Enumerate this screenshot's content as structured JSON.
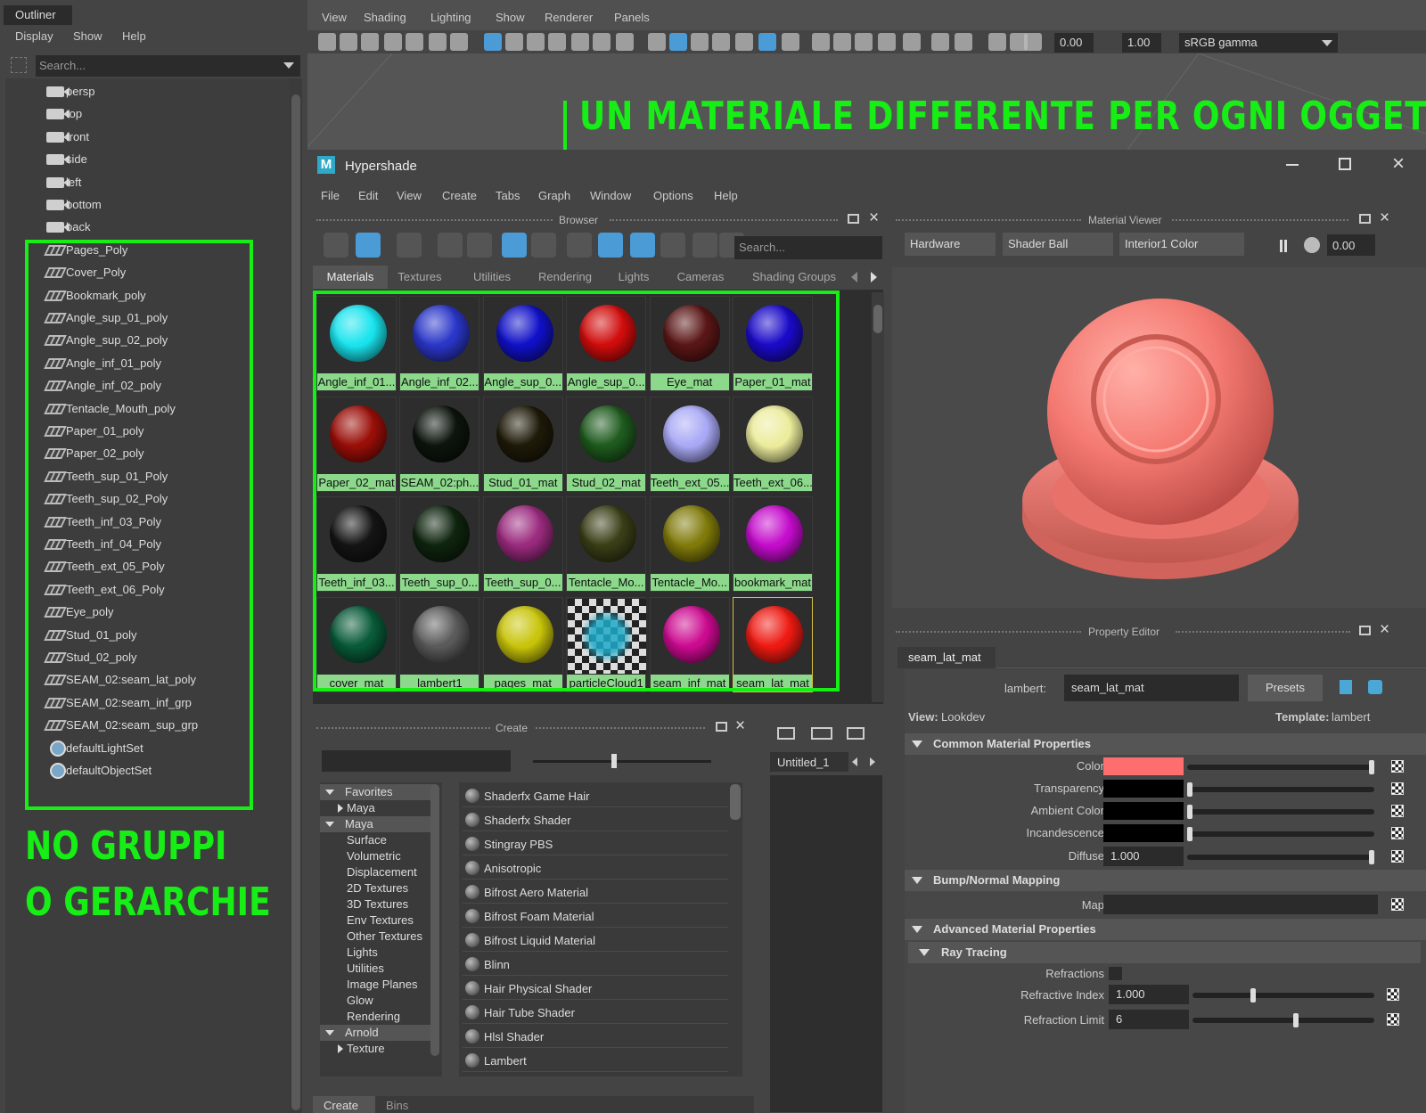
{
  "overlay": {
    "title": "UN MATERIALE DIFFERENTE PER OGNI OGGETTO",
    "note_line1": "NO GRUPPI",
    "note_line2": "O GERARCHIE",
    "accent": "#16ee16"
  },
  "outliner": {
    "title": "Outliner",
    "menu": [
      "Display",
      "Show",
      "Help"
    ],
    "search_placeholder": "Search...",
    "items": [
      {
        "label": "persp",
        "icon": "camera-icon"
      },
      {
        "label": "top",
        "icon": "camera-icon"
      },
      {
        "label": "front",
        "icon": "camera-icon"
      },
      {
        "label": "side",
        "icon": "camera-icon"
      },
      {
        "label": "left",
        "icon": "camera-icon"
      },
      {
        "label": "bottom",
        "icon": "camera-icon"
      },
      {
        "label": "back",
        "icon": "camera-icon"
      },
      {
        "label": "Pages_Poly",
        "icon": "mesh-icon"
      },
      {
        "label": "Cover_Poly",
        "icon": "mesh-icon"
      },
      {
        "label": "Bookmark_poly",
        "icon": "mesh-icon"
      },
      {
        "label": "Angle_sup_01_poly",
        "icon": "mesh-icon"
      },
      {
        "label": "Angle_sup_02_poly",
        "icon": "mesh-icon"
      },
      {
        "label": "Angle_inf_01_poly",
        "icon": "mesh-icon"
      },
      {
        "label": "Angle_inf_02_poly",
        "icon": "mesh-icon"
      },
      {
        "label": "Tentacle_Mouth_poly",
        "icon": "mesh-icon"
      },
      {
        "label": "Paper_01_poly",
        "icon": "mesh-icon"
      },
      {
        "label": "Paper_02_poly",
        "icon": "mesh-icon"
      },
      {
        "label": "Teeth_sup_01_Poly",
        "icon": "mesh-icon"
      },
      {
        "label": "Teeth_sup_02_Poly",
        "icon": "mesh-icon"
      },
      {
        "label": "Teeth_inf_03_Poly",
        "icon": "mesh-icon"
      },
      {
        "label": "Teeth_inf_04_Poly",
        "icon": "mesh-icon"
      },
      {
        "label": "Teeth_ext_05_Poly",
        "icon": "mesh-icon"
      },
      {
        "label": "Teeth_ext_06_Poly",
        "icon": "mesh-icon"
      },
      {
        "label": "Eye_poly",
        "icon": "mesh-icon"
      },
      {
        "label": "Stud_01_poly",
        "icon": "mesh-icon"
      },
      {
        "label": "Stud_02_poly",
        "icon": "mesh-icon"
      },
      {
        "label": "SEAM_02:seam_lat_poly",
        "icon": "mesh-icon"
      },
      {
        "label": "SEAM_02:seam_inf_grp",
        "icon": "mesh-icon"
      },
      {
        "label": "SEAM_02:seam_sup_grp",
        "icon": "mesh-icon"
      },
      {
        "label": "defaultLightSet",
        "icon": "set-icon"
      },
      {
        "label": "defaultObjectSet",
        "icon": "set-icon"
      }
    ]
  },
  "viewport": {
    "menu": [
      "View",
      "Shading",
      "Lighting",
      "Show",
      "Renderer",
      "Panels"
    ],
    "exposure": "0.00",
    "gamma": "1.00",
    "color_space": "sRGB gamma"
  },
  "hypershade": {
    "title": "Hypershade",
    "menu": [
      "File",
      "Edit",
      "View",
      "Create",
      "Tabs",
      "Graph",
      "Window",
      "Options",
      "Help"
    ],
    "browser": {
      "title": "Browser",
      "search_placeholder": "Search...",
      "tabs": [
        "Materials",
        "Textures",
        "Utilities",
        "Rendering",
        "Lights",
        "Cameras",
        "Shading Groups"
      ],
      "materials": [
        {
          "name": "Angle_inf_01...",
          "color": "#19e4ee"
        },
        {
          "name": "Angle_inf_02...",
          "color": "#2a36c8"
        },
        {
          "name": "Angle_sup_0...",
          "color": "#1010c8"
        },
        {
          "name": "Angle_sup_0...",
          "color": "#d00c0c"
        },
        {
          "name": "Eye_mat",
          "color": "#5a1616"
        },
        {
          "name": "Paper_01_mat",
          "color": "#1a0ac8"
        },
        {
          "name": "Paper_02_mat",
          "color": "#9a0e08"
        },
        {
          "name": "SEAM_02:ph...",
          "color": "#0c140c"
        },
        {
          "name": "Stud_01_mat",
          "color": "#1e1a08"
        },
        {
          "name": "Stud_02_mat",
          "color": "#1e5a1e"
        },
        {
          "name": "Teeth_ext_05...",
          "color": "#a8a8f6"
        },
        {
          "name": "Teeth_ext_06...",
          "color": "#ecec9c"
        },
        {
          "name": "Teeth_inf_03...",
          "color": "#141414"
        },
        {
          "name": "Teeth_sup_0...",
          "color": "#0e240e"
        },
        {
          "name": "Teeth_sup_0...",
          "color": "#9a2a7e"
        },
        {
          "name": "Tentacle_Mo...",
          "color": "#3a3e16"
        },
        {
          "name": "Tentacle_Mo...",
          "color": "#807a0a"
        },
        {
          "name": "bookmark_mat",
          "color": "#c40ccc"
        },
        {
          "name": "cover_mat",
          "color": "#085a38"
        },
        {
          "name": "lambert1",
          "color": "#5a5a5a"
        },
        {
          "name": "pages_mat",
          "color": "#c8c40a"
        },
        {
          "name": "particleCloud1",
          "color": "checker"
        },
        {
          "name": "seam_inf_mat",
          "color": "#cc0a90"
        },
        {
          "name": "seam_lat_mat",
          "color": "#ee1a12"
        }
      ]
    },
    "material_viewer": {
      "title": "Material Viewer",
      "renderer": "Hardware",
      "geometry": "Shader Ball",
      "environment": "Interior1 Color",
      "exposure": "0.00"
    },
    "property_editor": {
      "title": "Property Editor",
      "tab": "seam_lat_mat",
      "type_label": "lambert:",
      "name": "seam_lat_mat",
      "presets": "Presets",
      "view_label": "View:",
      "view_value": "Lookdev",
      "template_label": "Template:",
      "template_value": "lambert",
      "sections": {
        "common": "Common Material Properties",
        "bump": "Bump/Normal Mapping",
        "advanced": "Advanced Material Properties",
        "ray": "Ray Tracing"
      },
      "attrs": {
        "color": {
          "label": "Color",
          "value": "#ff6e6e"
        },
        "transparency": {
          "label": "Transparency",
          "value": "#000000"
        },
        "ambient": {
          "label": "Ambient Color",
          "value": "#000000"
        },
        "incandescence": {
          "label": "Incandescence",
          "value": "#000000"
        },
        "diffuse": {
          "label": "Diffuse",
          "value": "1.000"
        },
        "map": {
          "label": "Map"
        },
        "refractions": {
          "label": "Refractions"
        },
        "refractive_index": {
          "label": "Refractive Index",
          "value": "1.000"
        },
        "refraction_limit": {
          "label": "Refraction Limit",
          "value": "6"
        }
      }
    },
    "create": {
      "title": "Create",
      "tree": [
        {
          "label": "Favorites",
          "type": "header"
        },
        {
          "label": "Maya",
          "type": "sub"
        },
        {
          "label": "Maya",
          "type": "header"
        },
        {
          "label": "Surface",
          "type": "leaf"
        },
        {
          "label": "Volumetric",
          "type": "leaf"
        },
        {
          "label": "Displacement",
          "type": "leaf"
        },
        {
          "label": "2D Textures",
          "type": "leaf"
        },
        {
          "label": "3D Textures",
          "type": "leaf"
        },
        {
          "label": "Env Textures",
          "type": "leaf"
        },
        {
          "label": "Other Textures",
          "type": "leaf"
        },
        {
          "label": "Lights",
          "type": "leaf"
        },
        {
          "label": "Utilities",
          "type": "leaf"
        },
        {
          "label": "Image Planes",
          "type": "leaf"
        },
        {
          "label": "Glow",
          "type": "leaf"
        },
        {
          "label": "Rendering",
          "type": "leaf"
        },
        {
          "label": "Arnold",
          "type": "header"
        },
        {
          "label": "Texture",
          "type": "sub"
        }
      ],
      "nodes": [
        "Shaderfx Game Hair",
        "Shaderfx Shader",
        "Stingray PBS",
        "Anisotropic",
        "Bifrost Aero Material",
        "Bifrost Foam Material",
        "Bifrost Liquid Material",
        "Blinn",
        "Hair Physical Shader",
        "Hair Tube Shader",
        "Hlsl Shader",
        "Lambert"
      ],
      "bottom_tabs": [
        "Create",
        "Bins"
      ]
    },
    "graph_tab": "Untitled_1"
  }
}
